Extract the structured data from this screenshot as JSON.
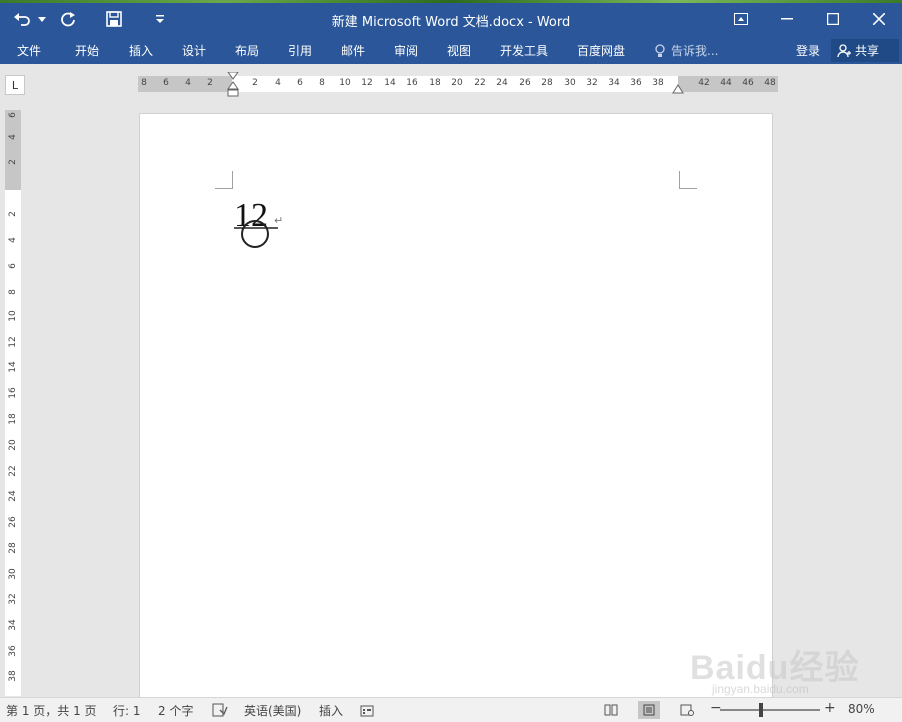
{
  "window": {
    "title": "新建 Microsoft Word 文档.docx - Word",
    "accent_color": "#2b579a"
  },
  "qat": {
    "icons": [
      "undo-icon",
      "redo-icon",
      "save-icon",
      "customize-icon"
    ]
  },
  "ribbon": {
    "tabs": [
      "文件",
      "开始",
      "插入",
      "设计",
      "布局",
      "引用",
      "邮件",
      "审阅",
      "视图",
      "开发工具",
      "百度网盘"
    ],
    "tell_me": "告诉我...",
    "login": "登录",
    "share": "共享"
  },
  "ruler": {
    "tab_selector": "L",
    "h_ticks": [
      "8",
      "6",
      "4",
      "2",
      "2",
      "4",
      "6",
      "8",
      "10",
      "12",
      "14",
      "16",
      "18",
      "20",
      "22",
      "24",
      "26",
      "28",
      "30",
      "32",
      "34",
      "36",
      "38",
      "42",
      "44",
      "46",
      "48"
    ],
    "v_ticks": [
      "6",
      "4",
      "2",
      "2",
      "4",
      "6",
      "8",
      "10",
      "12",
      "14",
      "16",
      "18",
      "20",
      "22",
      "24",
      "26",
      "28",
      "30",
      "32",
      "34",
      "36",
      "38"
    ]
  },
  "document": {
    "text": "12",
    "paragraph_mark": "↵"
  },
  "status": {
    "page": "第 1 页，共 1 页",
    "line": "行: 1",
    "words": "2 个字",
    "language": "英语(美国)",
    "mode": "插入",
    "zoom": "80%",
    "zoom_minus": "−",
    "zoom_plus": "+"
  },
  "watermark": {
    "main": "Baidu经验",
    "sub": "jingyan.baidu.com"
  }
}
